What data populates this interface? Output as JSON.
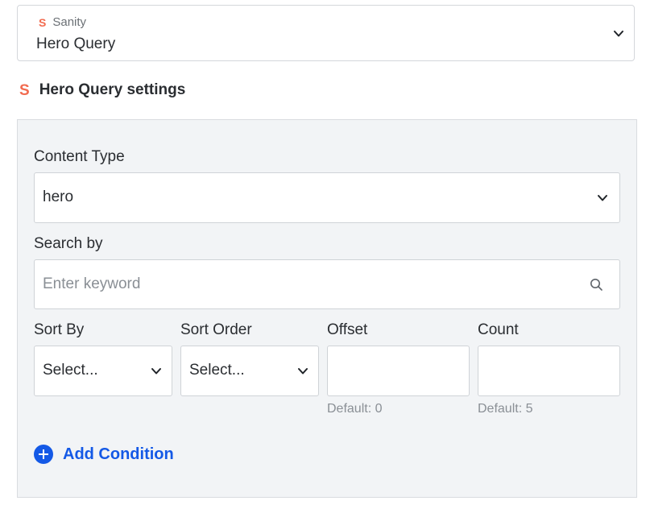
{
  "source": {
    "provider": "Sanity",
    "logo_letter": "S",
    "selected": "Hero Query"
  },
  "settings": {
    "logo_letter": "S",
    "title": "Hero Query settings"
  },
  "form": {
    "content_type": {
      "label": "Content Type",
      "value": "hero"
    },
    "search": {
      "label": "Search by",
      "placeholder": "Enter keyword"
    },
    "sort_by": {
      "label": "Sort By",
      "value": "Select..."
    },
    "sort_order": {
      "label": "Sort Order",
      "value": "Select..."
    },
    "offset": {
      "label": "Offset",
      "value": "",
      "hint": "Default: 0"
    },
    "count": {
      "label": "Count",
      "value": "",
      "hint": "Default: 5"
    },
    "add_condition_label": "Add Condition"
  },
  "colors": {
    "brand_orange": "#f26b4f",
    "accent_blue": "#1459e6",
    "panel_bg": "#f2f4f6"
  },
  "icons": {
    "source_chevron": "chevron-down-icon",
    "search": "search-icon",
    "add": "plus-circle-icon"
  }
}
